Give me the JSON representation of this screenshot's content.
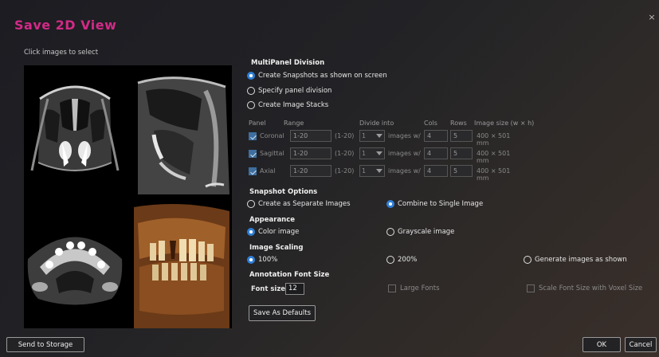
{
  "dialog": {
    "title": "Save 2D View",
    "close_glyph": "×",
    "hint": "Click images to select"
  },
  "multipanel": {
    "title": "MultiPanel Division",
    "options": [
      "Create Snapshots as shown on screen",
      "Specify panel division",
      "Create Image Stacks"
    ],
    "selected_index": 0
  },
  "table": {
    "headers": {
      "panel": "Panel",
      "range": "Range",
      "divide": "Divide into",
      "cols": "Cols",
      "rows": "Rows",
      "size": "Image size (w × h)"
    },
    "rows": [
      {
        "panel": "Coronal",
        "range": "1-20",
        "range_hint": "(1-20)",
        "divide": "1",
        "unit": "images w/",
        "cols": "4",
        "rows": "5",
        "size": "400 × 501 mm"
      },
      {
        "panel": "Sagittal",
        "range": "1-20",
        "range_hint": "(1-20)",
        "divide": "1",
        "unit": "images w/",
        "cols": "4",
        "rows": "5",
        "size": "400 × 501 mm"
      },
      {
        "panel": "Axial",
        "range": "1-20",
        "range_hint": "(1-20)",
        "divide": "1",
        "unit": "images w/",
        "cols": "4",
        "rows": "5",
        "size": "400 × 501 mm"
      }
    ]
  },
  "snapshot": {
    "title": "Snapshot Options",
    "options": [
      "Create as Separate Images",
      "Combine to Single Image"
    ],
    "selected_index": 1
  },
  "appearance": {
    "title": "Appearance",
    "options": [
      "Color image",
      "Grayscale image"
    ],
    "selected_index": 0
  },
  "scaling": {
    "title": "Image Scaling",
    "options": [
      "100%",
      "200%",
      "Generate images as shown"
    ],
    "selected_index": 0
  },
  "annotation": {
    "title": "Annotation Font Size",
    "font_size_label": "Font size",
    "font_size_value": "12",
    "large_fonts": "Large Fonts",
    "scale_font": "Scale Font Size with Voxel Size"
  },
  "buttons": {
    "save_defaults": "Save As Defaults",
    "send_storage": "Send to Storage",
    "ok": "OK",
    "cancel": "Cancel"
  },
  "colors": {
    "title": "#d22a86",
    "radio_selected": "#2f7fd8"
  }
}
